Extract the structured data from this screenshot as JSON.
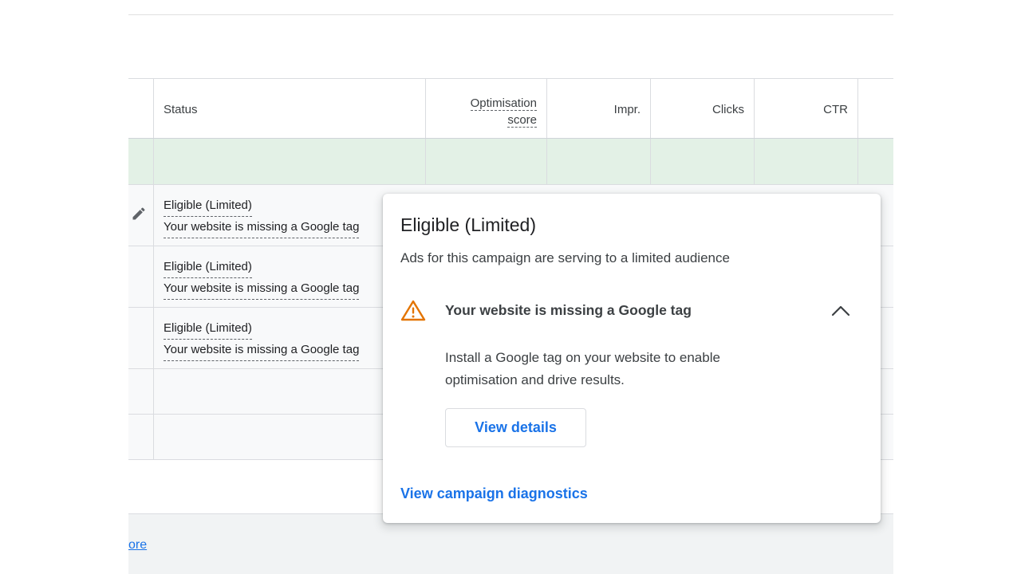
{
  "table": {
    "headers": {
      "status": "Status",
      "optimisation_line1": "Optimisation",
      "optimisation_line2": "score",
      "impr": "Impr.",
      "clicks": "Clicks",
      "ctr": "CTR"
    },
    "rows": [
      {
        "status": "Eligible (Limited)",
        "reason": "Your website is missing a Google tag"
      },
      {
        "status": "Eligible (Limited)",
        "reason": "Your website is missing a Google tag"
      },
      {
        "status": "Eligible (Limited)",
        "reason": "Your website is missing a Google tag"
      }
    ]
  },
  "footer": {
    "more_link": "ore"
  },
  "popup": {
    "title": "Eligible (Limited)",
    "subtitle": "Ads for this campaign are serving to a limited audience",
    "issue_title": "Your website is missing a Google tag",
    "issue_description": "Install a Google tag on your website to enable optimisation and drive results.",
    "view_details_label": "View details",
    "diagnostics_link": "View campaign diagnostics"
  },
  "icons": {
    "edit": "pencil-icon",
    "warning": "warning-icon",
    "collapse": "chevron-up-icon"
  },
  "colors": {
    "link": "#1a73e8",
    "warning": "#e37400",
    "total_row": "#e3f1e6"
  }
}
